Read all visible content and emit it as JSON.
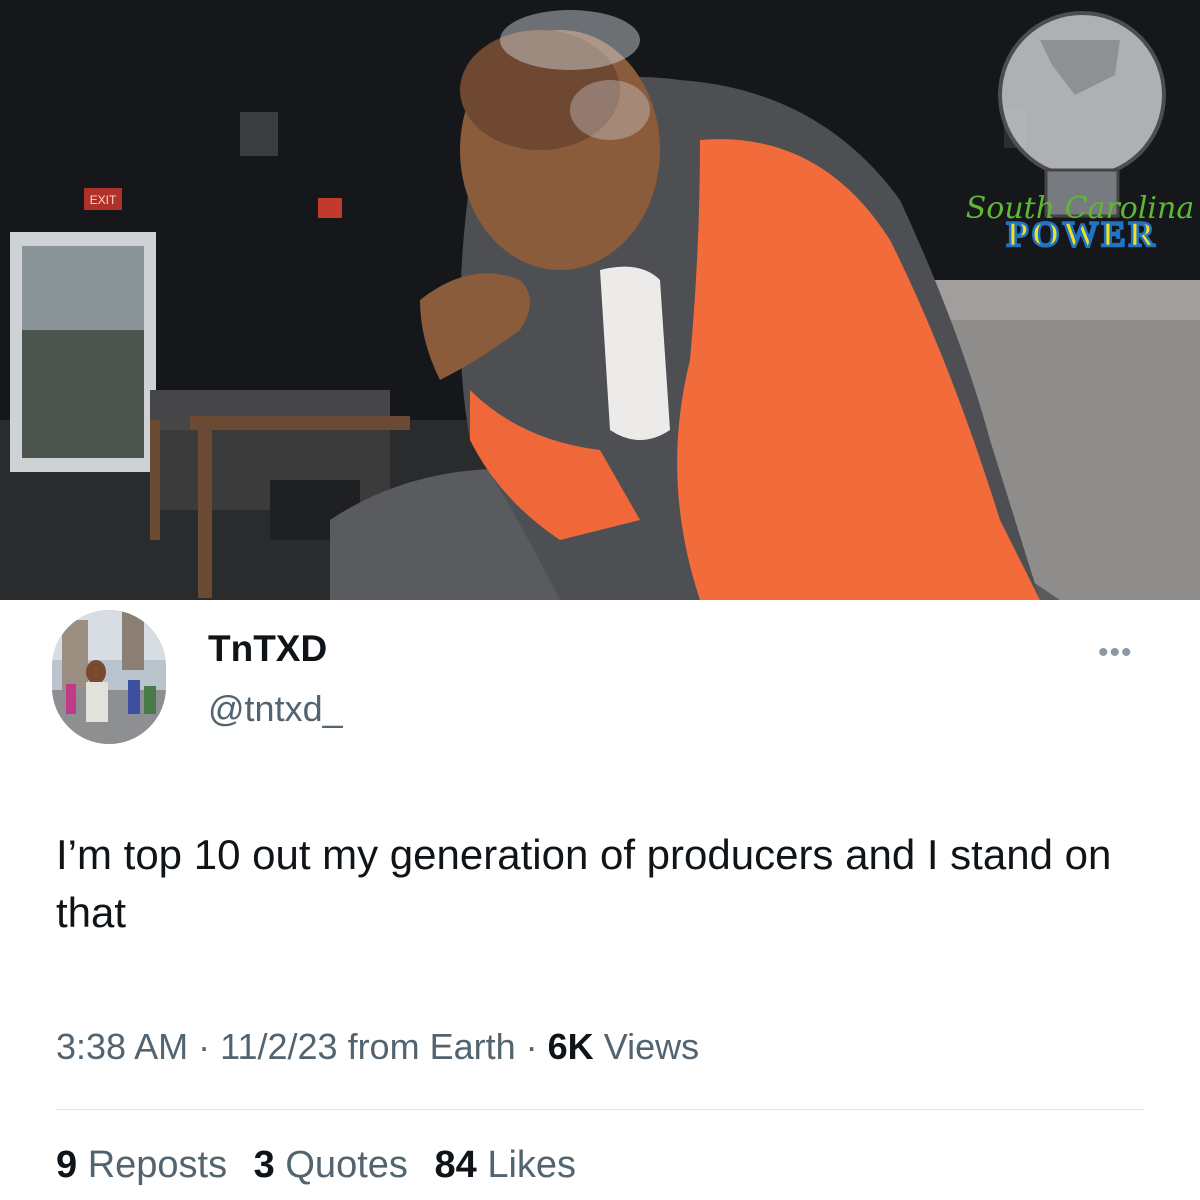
{
  "photo": {
    "alt": "Man in an orange and gray jacket smoking in a dim lounge",
    "exit_sign": "EXIT",
    "watermark": {
      "script_text": "South Carolina",
      "main_text": "POWER",
      "colors": {
        "green": "#5fb832",
        "yellow": "#f2e21a",
        "blue": "#1f74c8"
      }
    }
  },
  "tweet": {
    "display_name": "TnTXD",
    "handle": "@tntxd_",
    "more_label": "•••",
    "text": "I’m top 10 out my generation of producers and I stand on that",
    "time": "3:38 AM",
    "date_source": "11/2/23 from Earth",
    "views_count": "6K",
    "views_label": "Views",
    "separator": "·",
    "stats": {
      "reposts_count": "9",
      "reposts_label": "Reposts",
      "quotes_count": "3",
      "quotes_label": "Quotes",
      "likes_count": "84",
      "likes_label": "Likes"
    }
  }
}
